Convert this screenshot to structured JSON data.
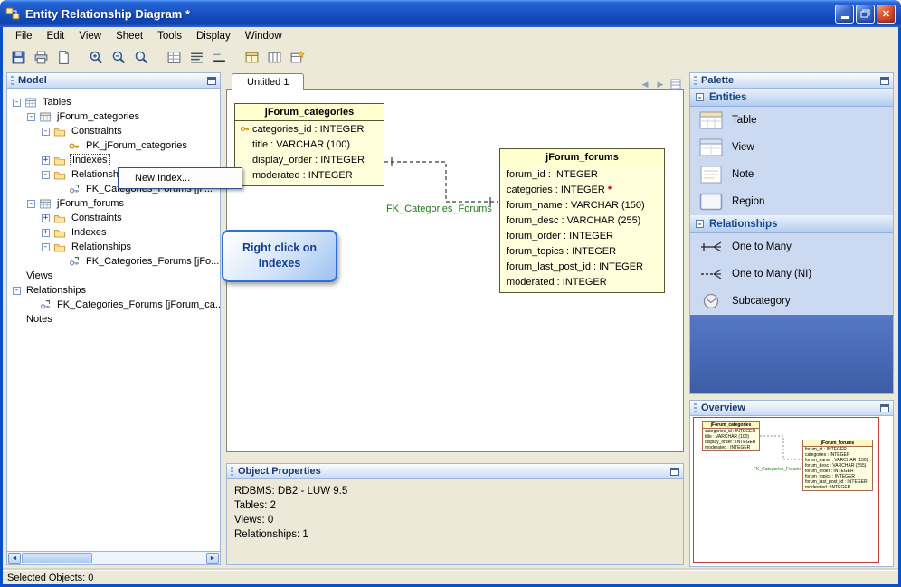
{
  "window": {
    "title": "Entity Relationship Diagram *"
  },
  "menubar": {
    "items": [
      "File",
      "Edit",
      "View",
      "Sheet",
      "Tools",
      "Display",
      "Window"
    ]
  },
  "toolbar": {
    "icons": [
      "save",
      "print",
      "print-preview",
      "zoom-in",
      "zoom-out",
      "zoom",
      "grid",
      "align-lines",
      "underline",
      "table",
      "table-columns",
      "table-new"
    ]
  },
  "model_panel": {
    "title": "Model",
    "tree": [
      {
        "label": "Tables",
        "depth": 0,
        "expander": "-",
        "icon": "table"
      },
      {
        "label": "jForum_categories",
        "depth": 1,
        "expander": "-",
        "icon": "table"
      },
      {
        "label": "Constraints",
        "depth": 2,
        "expander": "-",
        "icon": "folder"
      },
      {
        "label": "PK_jForum_categories",
        "depth": 3,
        "expander": "",
        "icon": "key"
      },
      {
        "label": "Indexes",
        "depth": 2,
        "expander": "+",
        "icon": "folder",
        "selected": true
      },
      {
        "label": "Relationships",
        "depth": 2,
        "expander": "-",
        "icon": "folder"
      },
      {
        "label": "FK_Categories_Forums [jF...",
        "depth": 3,
        "expander": "",
        "icon": "foreign-key"
      },
      {
        "label": "jForum_forums",
        "depth": 1,
        "expander": "-",
        "icon": "table"
      },
      {
        "label": "Constraints",
        "depth": 2,
        "expander": "+",
        "icon": "folder"
      },
      {
        "label": "Indexes",
        "depth": 2,
        "expander": "+",
        "icon": "folder"
      },
      {
        "label": "Relationships",
        "depth": 2,
        "expander": "-",
        "icon": "folder"
      },
      {
        "label": "FK_Categories_Forums [jFo...",
        "depth": 3,
        "expander": "",
        "icon": "foreign-key"
      },
      {
        "label": "Views",
        "depth": 0,
        "expander": "",
        "icon": ""
      },
      {
        "label": "Relationships",
        "depth": 0,
        "expander": "-",
        "icon": ""
      },
      {
        "label": "FK_Categories_Forums [jForum_ca...",
        "depth": 1,
        "expander": "",
        "icon": "foreign-key"
      },
      {
        "label": "Notes",
        "depth": 0,
        "expander": "",
        "icon": ""
      }
    ]
  },
  "context_menu": {
    "items": [
      "New Index..."
    ]
  },
  "callout": {
    "text": "Right click on Indexes"
  },
  "sheet": {
    "tab": "Untitled 1",
    "tables": [
      {
        "name": "jForum_categories",
        "fields": [
          {
            "icon": "primary-key",
            "text": "categories_id : INTEGER"
          },
          {
            "icon": "",
            "text": "title : VARCHAR (100)"
          },
          {
            "icon": "",
            "text": "display_order : INTEGER"
          },
          {
            "icon": "",
            "text": "moderated : INTEGER"
          }
        ]
      },
      {
        "name": "jForum_forums",
        "fields": [
          {
            "text": "forum_id : INTEGER"
          },
          {
            "text": "categories : INTEGER",
            "suffix": "*"
          },
          {
            "text": "forum_name : VARCHAR (150)"
          },
          {
            "text": "forum_desc : VARCHAR (255)"
          },
          {
            "text": "forum_order : INTEGER"
          },
          {
            "text": "forum_topics : INTEGER"
          },
          {
            "text": "forum_last_post_id : INTEGER"
          },
          {
            "text": "moderated : INTEGER"
          }
        ]
      }
    ],
    "relationship": {
      "label": "FK_Categories_Forums"
    }
  },
  "object_properties": {
    "title": "Object Properties",
    "lines": [
      "RDBMS: DB2 - LUW 9.5",
      "Tables: 2",
      "Views: 0",
      "Relationships: 1"
    ]
  },
  "palette": {
    "title": "Palette",
    "sections": [
      {
        "label": "Entities",
        "items": [
          {
            "icon": "table",
            "label": "Table"
          },
          {
            "icon": "view",
            "label": "View"
          },
          {
            "icon": "note",
            "label": "Note"
          },
          {
            "icon": "region",
            "label": "Region"
          }
        ]
      },
      {
        "label": "Relationships",
        "items": [
          {
            "icon": "one-to-many",
            "label": "One to Many"
          },
          {
            "icon": "one-to-many-ni",
            "label": "One to Many (NI)"
          },
          {
            "icon": "subcategory",
            "label": "Subcategory"
          }
        ]
      }
    ]
  },
  "overview": {
    "title": "Overview"
  },
  "statusbar": {
    "text": "Selected Objects: 0"
  },
  "colors": {
    "titlebar_blue": "#1C55C8",
    "panel_fill_blue": "#4A6DB8",
    "table_fill": "#FFFFDC",
    "relationship_label_green": "#1E7A1E",
    "overview_viewport_red": "#C83C3C"
  }
}
